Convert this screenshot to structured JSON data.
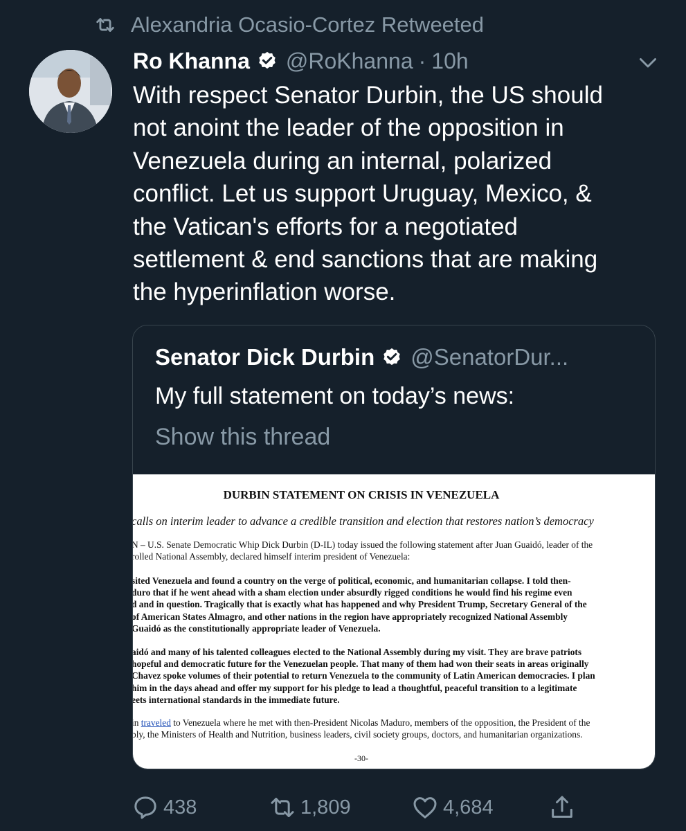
{
  "retweet_label": "Alexandria Ocasio-Cortez Retweeted",
  "tweet": {
    "display_name": "Ro Khanna",
    "handle": "@RoKhanna",
    "separator": "·",
    "time": "10h",
    "text": "With respect Senator Durbin, the US should\nnot anoint the leader of the opposition in\nVenezuela during an internal, polarized\nconflict. Let us support Uruguay, Mexico, &\nthe Vatican's efforts for a negotiated\nsettlement & end sanctions that are making\nthe hyperinflation worse."
  },
  "quote": {
    "display_name": "Senator Dick Durbin",
    "handle": "@SenatorDur...",
    "text": "My full statement on today’s news:",
    "show_thread": "Show this thread"
  },
  "document": {
    "title": "DURBIN STATEMENT ON CRISIS IN VENEZUELA",
    "subtitle": "calls on interim leader to advance a credible transition and election that restores nation’s democracy",
    "p1": "N – U.S. Senate Democratic Whip Dick Durbin (D-IL) today issued the following statement after Juan Guaidó, leader of the\nrolled National Assembly, declared himself interim president of Venezuela:",
    "p2": "sited Venezuela and found a country on the verge of political, economic, and humanitarian collapse.  I told then-\nduro that if he went ahead with a sham election under absurdly rigged conditions he would find his regime even\nd and in question.  Tragically that is exactly what has happened and why President Trump, Secretary General of the\nof American States Almagro, and other nations in the region have appropriately recognized National Assembly\n Guaidó as the constitutionally appropriate leader of Venezuela.",
    "p3": "aidó and many of his talented colleagues elected to the National Assembly during my visit.  They are brave patriots\n hopeful and democratic future for the Venezuelan people.  That many of them had won their seats in areas originally\nChavez spoke volumes of their potential to return Venezuela to the community of Latin American democracies.  I plan\nhim in the days ahead and offer my support for his pledge to lead a thoughtful, peaceful transition to a legitimate\neets international standards in the immediate future.",
    "p4_pre": "in ",
    "p4_link": "traveled",
    "p4_post": " to Venezuela where he met with then-President Nicolas Maduro, members of the opposition, the President of the",
    "p4_line2": "bly, the Ministers of Health and Nutrition, business leaders, civil society groups, doctors, and humanitarian organizations.",
    "end": "-30-"
  },
  "actions": {
    "replies": "438",
    "retweets": "1,809",
    "likes": "4,684"
  },
  "colors": {
    "background": "#15202b",
    "secondary_text": "#8899a6",
    "border": "#38444d",
    "link": "#1a4bb5"
  },
  "icons": [
    "retweet-icon",
    "verified-badge-icon",
    "chevron-down-icon",
    "reply-icon",
    "like-icon",
    "share-icon"
  ]
}
